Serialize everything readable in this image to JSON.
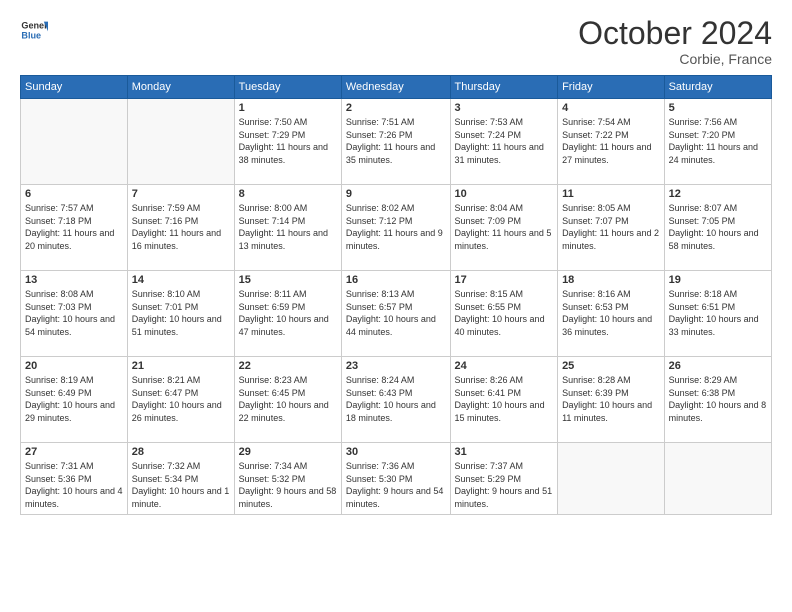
{
  "logo": {
    "text1": "General",
    "text2": "Blue"
  },
  "title": "October 2024",
  "subtitle": "Corbie, France",
  "headers": [
    "Sunday",
    "Monday",
    "Tuesday",
    "Wednesday",
    "Thursday",
    "Friday",
    "Saturday"
  ],
  "weeks": [
    [
      {
        "day": "",
        "info": ""
      },
      {
        "day": "",
        "info": ""
      },
      {
        "day": "1",
        "info": "Sunrise: 7:50 AM\nSunset: 7:29 PM\nDaylight: 11 hours and 38 minutes."
      },
      {
        "day": "2",
        "info": "Sunrise: 7:51 AM\nSunset: 7:26 PM\nDaylight: 11 hours and 35 minutes."
      },
      {
        "day": "3",
        "info": "Sunrise: 7:53 AM\nSunset: 7:24 PM\nDaylight: 11 hours and 31 minutes."
      },
      {
        "day": "4",
        "info": "Sunrise: 7:54 AM\nSunset: 7:22 PM\nDaylight: 11 hours and 27 minutes."
      },
      {
        "day": "5",
        "info": "Sunrise: 7:56 AM\nSunset: 7:20 PM\nDaylight: 11 hours and 24 minutes."
      }
    ],
    [
      {
        "day": "6",
        "info": "Sunrise: 7:57 AM\nSunset: 7:18 PM\nDaylight: 11 hours and 20 minutes."
      },
      {
        "day": "7",
        "info": "Sunrise: 7:59 AM\nSunset: 7:16 PM\nDaylight: 11 hours and 16 minutes."
      },
      {
        "day": "8",
        "info": "Sunrise: 8:00 AM\nSunset: 7:14 PM\nDaylight: 11 hours and 13 minutes."
      },
      {
        "day": "9",
        "info": "Sunrise: 8:02 AM\nSunset: 7:12 PM\nDaylight: 11 hours and 9 minutes."
      },
      {
        "day": "10",
        "info": "Sunrise: 8:04 AM\nSunset: 7:09 PM\nDaylight: 11 hours and 5 minutes."
      },
      {
        "day": "11",
        "info": "Sunrise: 8:05 AM\nSunset: 7:07 PM\nDaylight: 11 hours and 2 minutes."
      },
      {
        "day": "12",
        "info": "Sunrise: 8:07 AM\nSunset: 7:05 PM\nDaylight: 10 hours and 58 minutes."
      }
    ],
    [
      {
        "day": "13",
        "info": "Sunrise: 8:08 AM\nSunset: 7:03 PM\nDaylight: 10 hours and 54 minutes."
      },
      {
        "day": "14",
        "info": "Sunrise: 8:10 AM\nSunset: 7:01 PM\nDaylight: 10 hours and 51 minutes."
      },
      {
        "day": "15",
        "info": "Sunrise: 8:11 AM\nSunset: 6:59 PM\nDaylight: 10 hours and 47 minutes."
      },
      {
        "day": "16",
        "info": "Sunrise: 8:13 AM\nSunset: 6:57 PM\nDaylight: 10 hours and 44 minutes."
      },
      {
        "day": "17",
        "info": "Sunrise: 8:15 AM\nSunset: 6:55 PM\nDaylight: 10 hours and 40 minutes."
      },
      {
        "day": "18",
        "info": "Sunrise: 8:16 AM\nSunset: 6:53 PM\nDaylight: 10 hours and 36 minutes."
      },
      {
        "day": "19",
        "info": "Sunrise: 8:18 AM\nSunset: 6:51 PM\nDaylight: 10 hours and 33 minutes."
      }
    ],
    [
      {
        "day": "20",
        "info": "Sunrise: 8:19 AM\nSunset: 6:49 PM\nDaylight: 10 hours and 29 minutes."
      },
      {
        "day": "21",
        "info": "Sunrise: 8:21 AM\nSunset: 6:47 PM\nDaylight: 10 hours and 26 minutes."
      },
      {
        "day": "22",
        "info": "Sunrise: 8:23 AM\nSunset: 6:45 PM\nDaylight: 10 hours and 22 minutes."
      },
      {
        "day": "23",
        "info": "Sunrise: 8:24 AM\nSunset: 6:43 PM\nDaylight: 10 hours and 18 minutes."
      },
      {
        "day": "24",
        "info": "Sunrise: 8:26 AM\nSunset: 6:41 PM\nDaylight: 10 hours and 15 minutes."
      },
      {
        "day": "25",
        "info": "Sunrise: 8:28 AM\nSunset: 6:39 PM\nDaylight: 10 hours and 11 minutes."
      },
      {
        "day": "26",
        "info": "Sunrise: 8:29 AM\nSunset: 6:38 PM\nDaylight: 10 hours and 8 minutes."
      }
    ],
    [
      {
        "day": "27",
        "info": "Sunrise: 7:31 AM\nSunset: 5:36 PM\nDaylight: 10 hours and 4 minutes."
      },
      {
        "day": "28",
        "info": "Sunrise: 7:32 AM\nSunset: 5:34 PM\nDaylight: 10 hours and 1 minute."
      },
      {
        "day": "29",
        "info": "Sunrise: 7:34 AM\nSunset: 5:32 PM\nDaylight: 9 hours and 58 minutes."
      },
      {
        "day": "30",
        "info": "Sunrise: 7:36 AM\nSunset: 5:30 PM\nDaylight: 9 hours and 54 minutes."
      },
      {
        "day": "31",
        "info": "Sunrise: 7:37 AM\nSunset: 5:29 PM\nDaylight: 9 hours and 51 minutes."
      },
      {
        "day": "",
        "info": ""
      },
      {
        "day": "",
        "info": ""
      }
    ]
  ]
}
